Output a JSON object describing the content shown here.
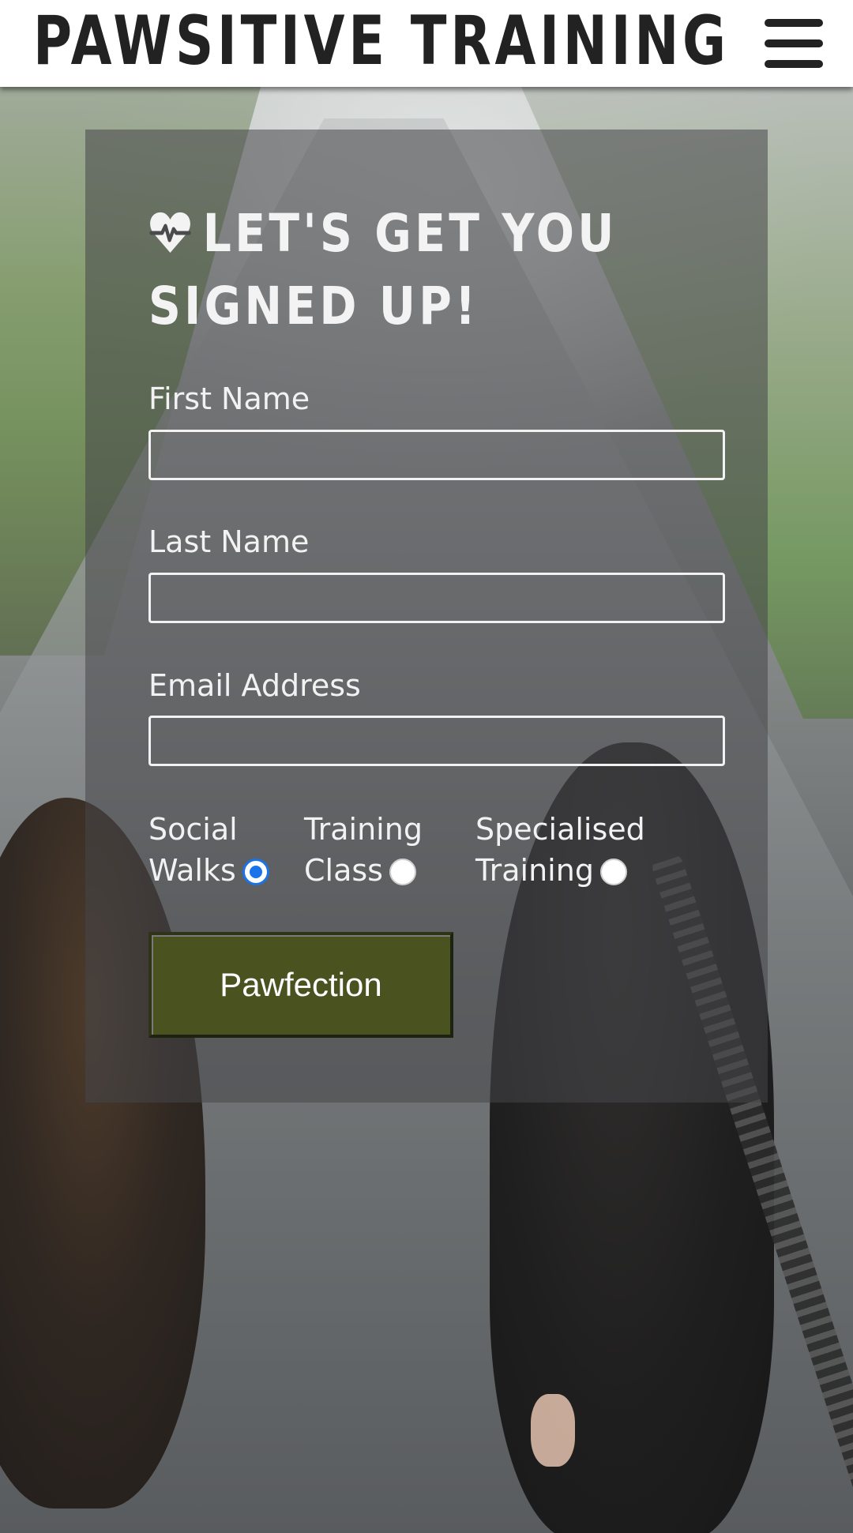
{
  "header": {
    "brand": "PAWSITIVE TRAINING",
    "menu_icon": "hamburger-menu-icon"
  },
  "signup": {
    "title_icon": "heartbeat-icon",
    "title": "LET'S GET YOU SIGNED UP!",
    "fields": [
      {
        "label": "First Name",
        "value": "",
        "placeholder": ""
      },
      {
        "label": "Last Name",
        "value": "",
        "placeholder": ""
      },
      {
        "label": "Email Address",
        "value": "",
        "placeholder": ""
      }
    ],
    "options": [
      {
        "line1": "Social",
        "line2": "Walks",
        "checked": true
      },
      {
        "line1": "Training",
        "line2": "Class",
        "checked": false
      },
      {
        "line1": "Specialised",
        "line2": "Training",
        "checked": false
      }
    ],
    "submit_label": "Pawfection"
  },
  "colors": {
    "header_bg": "#ffffff",
    "brand_text": "#222222",
    "card_bg": "rgba(70,70,72,0.55)",
    "button_bg": "#4a5220",
    "radio_selected": "#1a73e8"
  }
}
